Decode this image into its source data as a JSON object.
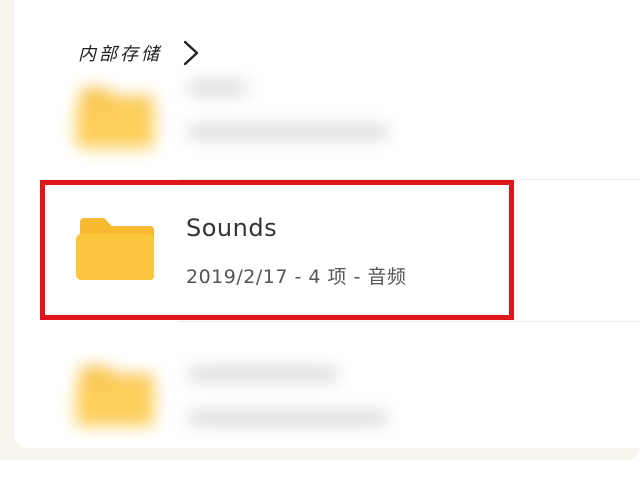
{
  "breadcrumb": {
    "label": "内部存储"
  },
  "folders": [
    {
      "name": "",
      "meta": "",
      "blurred": true
    },
    {
      "name": "Sounds",
      "meta": "2019/2/17 - 4 项 - 音频",
      "blurred": false,
      "highlighted": true
    },
    {
      "name": "",
      "meta": "",
      "blurred": true
    }
  ],
  "colors": {
    "folder_back": "#f7b92f",
    "folder_front": "#fcc63e",
    "highlight": "#e1161b"
  },
  "icons": {
    "breadcrumb_chevron": "chevron-right-icon",
    "folder": "folder-icon"
  }
}
